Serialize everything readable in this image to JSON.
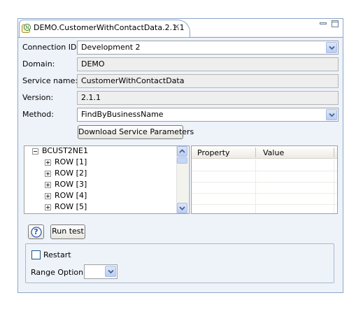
{
  "editor": {
    "tab_title": "DEMO.CustomerWithContactData.2.1.1",
    "tab_close_glyph": "✕",
    "tab_icon": "service-n-icon"
  },
  "form": {
    "connection_id": {
      "label": "Connection ID:",
      "value": "Development 2"
    },
    "domain": {
      "label": "Domain:",
      "value": "DEMO"
    },
    "service_name": {
      "label": "Service name:",
      "value": "CustomerWithContactData"
    },
    "version": {
      "label": "Version:",
      "value": "2.1.1"
    },
    "method": {
      "label": "Method:",
      "value": "FindByBusinessName"
    },
    "download_button": "Download Service Parameters"
  },
  "tree": {
    "root": "BCUST2NE1",
    "items": [
      "ROW [1]",
      "ROW [2]",
      "ROW [3]",
      "ROW [4]",
      "ROW [5]"
    ]
  },
  "properties": {
    "headers": [
      "Property",
      "Value"
    ]
  },
  "actions": {
    "help_glyph": "?",
    "run_test": "Run test"
  },
  "options": {
    "restart_label": "Restart",
    "restart_checked": false,
    "range_label": "Range Option:",
    "range_value": ""
  },
  "colors": {
    "frame_border": "#8aa6c8",
    "panel_bg": "#eef3fa",
    "combo_button": "#b8cdf4"
  }
}
